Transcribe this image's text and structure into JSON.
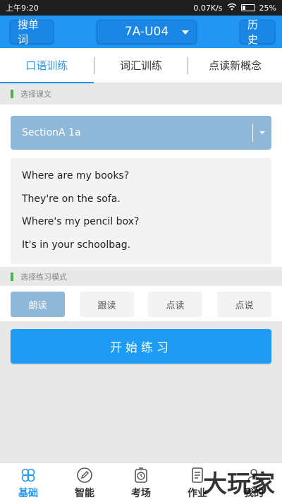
{
  "status_bar": {
    "time": "上午9:20",
    "net_speed": "0.07K/s",
    "battery": "25%"
  },
  "header": {
    "search_word_label": "搜单词",
    "unit_value": "7A-U04",
    "history_label": "历史"
  },
  "tabs": [
    {
      "label": "口语训练",
      "active": true
    },
    {
      "label": "词汇训练",
      "active": false
    },
    {
      "label": "点读新概念",
      "active": false
    }
  ],
  "lesson_section": {
    "title": "选择课文",
    "selected_lesson": "SectionA 1a",
    "sentences": [
      "Where are my books?",
      "They're on the sofa.",
      "Where's my pencil box?",
      "It's in your schoolbag."
    ]
  },
  "mode_section": {
    "title": "选择练习模式",
    "modes": [
      {
        "label": "朗读",
        "active": true
      },
      {
        "label": "跟读",
        "active": false
      },
      {
        "label": "点读",
        "active": false
      },
      {
        "label": "点说",
        "active": false
      }
    ]
  },
  "start_button_label": "开始练习",
  "bottom_nav": [
    {
      "label": "基础",
      "icon": "clover-icon",
      "active": true
    },
    {
      "label": "智能",
      "icon": "pencil-circle-icon",
      "active": false
    },
    {
      "label": "考场",
      "icon": "stopwatch-icon",
      "active": false
    },
    {
      "label": "作业",
      "icon": "document-icon",
      "active": false
    },
    {
      "label": "我的",
      "icon": "person-icon",
      "active": false
    }
  ],
  "watermark": "大玩家",
  "colors": {
    "primary": "#2196f3",
    "selected_muted": "#8fb8d8",
    "section_bar": "#4caf50"
  }
}
